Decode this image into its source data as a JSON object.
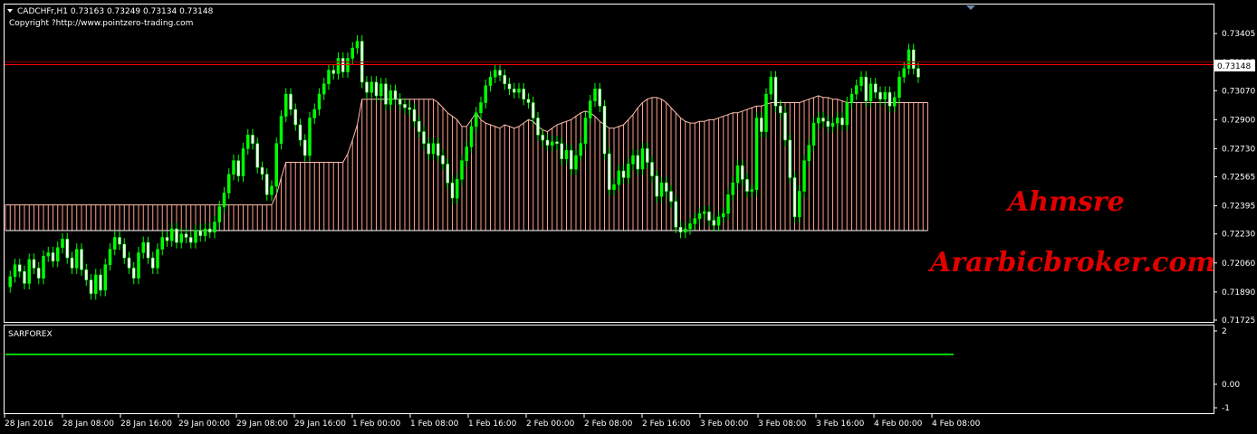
{
  "header": {
    "symbol_line": "CADCHFr,H1  0.73163 0.73249 0.73134 0.73148",
    "copyright": "Copyright ?http://www.pointzero-trading.com"
  },
  "watermark": {
    "line1": "Ahmsre",
    "line2": "Ararbicbroker.com"
  },
  "indicator": {
    "title": "SARFOREX",
    "ticks": [
      "2",
      "0.00",
      "-1"
    ],
    "level": 1.4
  },
  "current_price": "0.73148",
  "colors": {
    "bull": "#00ff00",
    "bear": "#ffffff",
    "cloud_bear": "#ff9d8a",
    "cloud_bull": "#6fb2ff",
    "price_line": "#ff0000",
    "indicator_line": "#00d000",
    "frame": "#ffffff"
  },
  "chart_data": [
    {
      "type": "candlestick",
      "title": "CADCHFr,H1",
      "xlabel": "",
      "ylabel": "",
      "ylim": [
        0.71725,
        0.73485
      ],
      "yticks": [
        "0.73405",
        "0.73235",
        "0.73070",
        "0.72900",
        "0.72730",
        "0.72565",
        "0.72395",
        "0.72230",
        "0.72060",
        "0.71890",
        "0.71725"
      ],
      "xticks": [
        "28 Jan 2016",
        "28 Jan 08:00",
        "28 Jan 16:00",
        "29 Jan 00:00",
        "29 Jan 08:00",
        "29 Jan 16:00",
        "1 Feb 00:00",
        "1 Feb 08:00",
        "1 Feb 16:00",
        "2 Feb 00:00",
        "2 Feb 08:00",
        "2 Feb 16:00",
        "3 Feb 00:00",
        "3 Feb 08:00",
        "3 Feb 16:00",
        "4 Feb 00:00",
        "4 Feb 08:00"
      ],
      "grid": false,
      "close": [
        0.7192,
        0.7198,
        0.7205,
        0.7201,
        0.7194,
        0.7208,
        0.7203,
        0.7197,
        0.721,
        0.7212,
        0.7207,
        0.7215,
        0.722,
        0.7209,
        0.7203,
        0.7214,
        0.7202,
        0.7196,
        0.7188,
        0.7199,
        0.719,
        0.7205,
        0.7214,
        0.7221,
        0.7217,
        0.7209,
        0.7203,
        0.7197,
        0.7212,
        0.7218,
        0.7209,
        0.7203,
        0.7214,
        0.7221,
        0.7219,
        0.7226,
        0.7218,
        0.7223,
        0.7221,
        0.7218,
        0.7225,
        0.7222,
        0.7226,
        0.7224,
        0.723,
        0.7239,
        0.7247,
        0.7258,
        0.7266,
        0.7257,
        0.7273,
        0.7281,
        0.7276,
        0.7262,
        0.7258,
        0.7246,
        0.7251,
        0.7276,
        0.7292,
        0.7305,
        0.7296,
        0.7287,
        0.7278,
        0.7269,
        0.7291,
        0.7296,
        0.7305,
        0.7311,
        0.7319,
        0.7317,
        0.7326,
        0.7318,
        0.7326,
        0.7332,
        0.7336,
        0.7312,
        0.7306,
        0.7312,
        0.7304,
        0.7311,
        0.7299,
        0.7307,
        0.7302,
        0.7299,
        0.7297,
        0.7296,
        0.7289,
        0.7283,
        0.7276,
        0.727,
        0.7276,
        0.7269,
        0.7264,
        0.7253,
        0.7244,
        0.7255,
        0.7266,
        0.7274,
        0.7286,
        0.7294,
        0.73,
        0.731,
        0.7315,
        0.7319,
        0.7316,
        0.7311,
        0.7308,
        0.7306,
        0.7308,
        0.7302,
        0.73,
        0.7291,
        0.7281,
        0.7278,
        0.7275,
        0.7277,
        0.7276,
        0.7267,
        0.7272,
        0.7261,
        0.7269,
        0.7276,
        0.7291,
        0.7301,
        0.7308,
        0.7298,
        0.727,
        0.7249,
        0.7252,
        0.726,
        0.7256,
        0.7264,
        0.7269,
        0.7261,
        0.7273,
        0.7265,
        0.7257,
        0.7245,
        0.7253,
        0.7248,
        0.7242,
        0.7227,
        0.7224,
        0.7226,
        0.7229,
        0.7232,
        0.7235,
        0.7236,
        0.7231,
        0.7228,
        0.7233,
        0.7235,
        0.7246,
        0.7253,
        0.7263,
        0.7255,
        0.7248,
        0.7249,
        0.7291,
        0.7283,
        0.7305,
        0.7315,
        0.7298,
        0.7294,
        0.7278,
        0.7256,
        0.7233,
        0.7248,
        0.7266,
        0.7275,
        0.7288,
        0.7291,
        0.7289,
        0.7286,
        0.7288,
        0.7291,
        0.7287,
        0.73,
        0.7305,
        0.731,
        0.7315,
        0.7301,
        0.7311,
        0.7306,
        0.7302,
        0.7306,
        0.7298,
        0.7303,
        0.7315,
        0.732,
        0.7331,
        0.732,
        0.7315
      ],
      "ichimoku": {
        "span_a": [
          0.724,
          0.724,
          0.724,
          0.724,
          0.724,
          0.724,
          0.724,
          0.724,
          0.724,
          0.724,
          0.724,
          0.724,
          0.724,
          0.724,
          0.724,
          0.724,
          0.724,
          0.724,
          0.724,
          0.724,
          0.724,
          0.724,
          0.724,
          0.724,
          0.724,
          0.724,
          0.724,
          0.724,
          0.724,
          0.724,
          0.724,
          0.724,
          0.724,
          0.724,
          0.724,
          0.724,
          0.724,
          0.724,
          0.724,
          0.724,
          0.724,
          0.724,
          0.724,
          0.724,
          0.724,
          0.724,
          0.724,
          0.724,
          0.724,
          0.724,
          0.724,
          0.724,
          0.724,
          0.724,
          0.724,
          0.724,
          0.724,
          0.7246,
          0.7256,
          0.7265,
          0.7265,
          0.7265,
          0.7265,
          0.7265,
          0.7265,
          0.7265,
          0.7265,
          0.7265,
          0.7265,
          0.7265,
          0.7265,
          0.7265,
          0.727,
          0.7278,
          0.7287,
          0.7302,
          0.7302,
          0.7302,
          0.7302,
          0.7302,
          0.7302,
          0.7302,
          0.7302,
          0.7302,
          0.7302,
          0.7302,
          0.7302,
          0.7302,
          0.7302,
          0.7302,
          0.7302,
          0.73,
          0.7297,
          0.7294,
          0.7292,
          0.729,
          0.7286,
          0.7286,
          0.729,
          0.7294,
          0.729,
          0.7288,
          0.7287,
          0.7286,
          0.7285,
          0.7287,
          0.7286,
          0.7285,
          0.7286,
          0.7288,
          0.729,
          0.7289,
          0.7286,
          0.7284,
          0.7283,
          0.7285,
          0.7287,
          0.7288,
          0.7289,
          0.729,
          0.7292,
          0.7294,
          0.7295,
          0.7294,
          0.7292,
          0.7289,
          0.7287,
          0.7285,
          0.7285,
          0.7286,
          0.7287,
          0.729,
          0.7293,
          0.7297,
          0.73,
          0.7302,
          0.7303,
          0.7303,
          0.7302,
          0.73,
          0.7297,
          0.7294,
          0.7291,
          0.7289,
          0.7288,
          0.7288,
          0.7289,
          0.7289,
          0.729,
          0.729,
          0.7291,
          0.7292,
          0.7293,
          0.7294,
          0.7294,
          0.7295,
          0.7296,
          0.7297,
          0.7298,
          0.7298,
          0.7299,
          0.73,
          0.73,
          0.73,
          0.73,
          0.73,
          0.73,
          0.73,
          0.7301,
          0.7302,
          0.7303,
          0.7304,
          0.7303,
          0.7303,
          0.7302,
          0.7302,
          0.7301,
          0.73,
          0.73,
          0.73,
          0.73,
          0.73,
          0.73,
          0.73,
          0.73,
          0.73,
          0.73,
          0.73,
          0.73,
          0.73,
          0.73,
          0.73,
          0.73,
          0.73,
          0.73
        ],
        "span_b": [
          0.7225,
          0.7225,
          0.7225,
          0.7225,
          0.7225,
          0.7225,
          0.7225,
          0.7225,
          0.7225,
          0.7225,
          0.7225,
          0.7225,
          0.7225,
          0.7225,
          0.7225,
          0.7225,
          0.7225,
          0.7225,
          0.7225,
          0.7225,
          0.7225,
          0.7225,
          0.7225,
          0.7225,
          0.7225,
          0.7225,
          0.7225,
          0.7225,
          0.7225,
          0.7225,
          0.7225,
          0.7225,
          0.7225,
          0.7225,
          0.7225,
          0.7225,
          0.7225,
          0.7225,
          0.7225,
          0.7225,
          0.7225,
          0.7225,
          0.7225,
          0.7225,
          0.7225,
          0.7225,
          0.7225,
          0.7225,
          0.7225,
          0.7225,
          0.7225,
          0.7225,
          0.7225,
          0.7225,
          0.7225,
          0.7225,
          0.7225,
          0.7225,
          0.7225,
          0.7225,
          0.7225,
          0.7225,
          0.7225,
          0.7225,
          0.7225,
          0.7225,
          0.7225,
          0.7225,
          0.7225,
          0.7225,
          0.7225,
          0.7225,
          0.7225,
          0.7225,
          0.7225,
          0.7225,
          0.7225,
          0.7225,
          0.7225,
          0.7225,
          0.7225,
          0.7225,
          0.7225,
          0.7225,
          0.7225,
          0.7225,
          0.7225,
          0.7225,
          0.7225,
          0.7225,
          0.7225,
          0.7225,
          0.7225,
          0.7225,
          0.7225,
          0.7225,
          0.7225,
          0.7225,
          0.7225,
          0.7225,
          0.7225,
          0.7225,
          0.7225,
          0.7225,
          0.7225,
          0.7225,
          0.7225,
          0.7225,
          0.7225,
          0.7225,
          0.7225,
          0.7225,
          0.7225,
          0.7225,
          0.7225,
          0.7225,
          0.7225,
          0.7225,
          0.7225,
          0.7225,
          0.7225,
          0.7225,
          0.7225,
          0.7225,
          0.7225,
          0.7225,
          0.7225,
          0.7225,
          0.7225,
          0.7225,
          0.7225,
          0.7225,
          0.7225,
          0.7225,
          0.7225,
          0.7225,
          0.7225,
          0.7225,
          0.7225,
          0.7225,
          0.7225,
          0.7225,
          0.7225,
          0.7225,
          0.7225,
          0.7225,
          0.7225,
          0.7225,
          0.7225,
          0.7225,
          0.7225,
          0.7225,
          0.7225,
          0.7225,
          0.7225,
          0.7225,
          0.7225,
          0.7225,
          0.7225,
          0.7225,
          0.7225,
          0.7225,
          0.7225,
          0.7225,
          0.7225,
          0.7225,
          0.7225,
          0.7225,
          0.7225,
          0.7225,
          0.7225,
          0.7225,
          0.7225,
          0.7225,
          0.7225,
          0.7225,
          0.7225,
          0.7225,
          0.7225,
          0.7225,
          0.7225,
          0.7225,
          0.7225,
          0.7225,
          0.7225,
          0.7225,
          0.7225,
          0.7225,
          0.7225,
          0.7225,
          0.7225,
          0.7225,
          0.7225,
          0.7225,
          0.7225,
          0.7225,
          0.7225,
          0.7225,
          0.7225,
          0.7225
        ],
        "note": ""
      }
    }
  ]
}
